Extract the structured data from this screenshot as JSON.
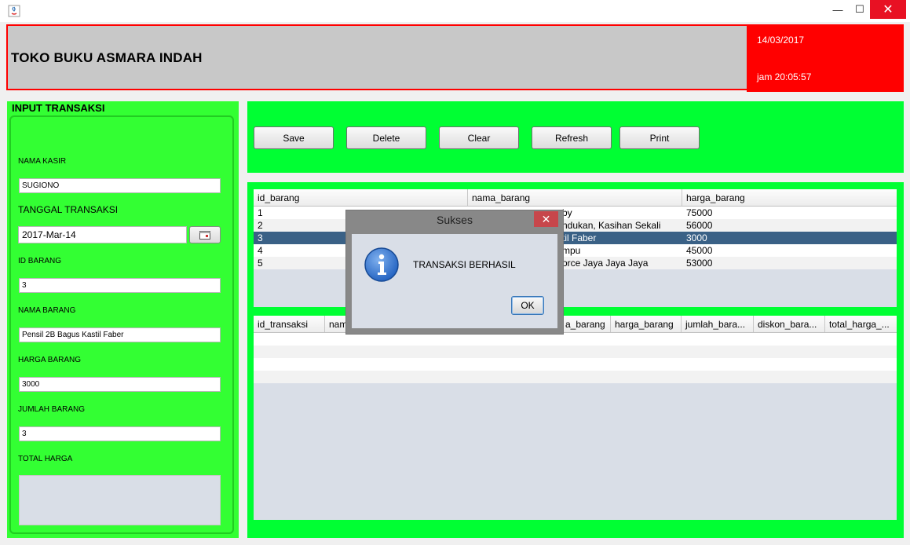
{
  "window": {
    "minimize_glyph": "—",
    "maximize_glyph": "☐",
    "close_glyph": "✕"
  },
  "header": {
    "store_name": "TOKO BUKU ASMARA INDAH",
    "date": "14/03/2017",
    "time": "jam 20:05:57"
  },
  "input_panel": {
    "title": "INPUT TRANSAKSI",
    "nama_kasir_label": "NAMA KASIR",
    "nama_kasir_value": "SUGIONO",
    "tanggal_label": "TANGGAL TRANSAKSI",
    "tanggal_value": "2017-Mar-14",
    "id_barang_label": "ID BARANG",
    "id_barang_value": "3",
    "nama_barang_label": "NAMA BARANG",
    "nama_barang_value": "Pensil 2B Bagus Kastil Faber",
    "harga_barang_label": "HARGA BARANG",
    "harga_barang_value": "3000",
    "jumlah_barang_label": "JUMLAH BARANG",
    "jumlah_barang_value": "3",
    "total_harga_label": "TOTAL HARGA",
    "total_harga_value": ""
  },
  "toolbar": {
    "save": "Save",
    "delete": "Delete",
    "clear": "Clear",
    "refresh": "Refresh",
    "print": "Print"
  },
  "barang_table": {
    "columns": [
      "id_barang",
      "nama_barang",
      "harga_barang"
    ],
    "rows": [
      [
        "1",
        "by",
        "75000"
      ],
      [
        "2",
        "ndukan, Kasihan Sekali",
        "56000"
      ],
      [
        "3",
        "til Faber",
        "3000"
      ],
      [
        "4",
        "mpu",
        "45000"
      ],
      [
        "5",
        "orce Jaya Jaya Jaya",
        "53000"
      ]
    ]
  },
  "transaksi_table": {
    "columns": [
      "id_transaksi",
      "nam",
      "a_barang",
      "harga_barang",
      "jumlah_bara...",
      "diskon_bara...",
      "total_harga_..."
    ]
  },
  "dialog": {
    "title": "Sukses",
    "message": "TRANSAKSI BERHASIL",
    "ok": "OK",
    "close_glyph": "✕"
  },
  "colors": {
    "header_red": "#ff0000",
    "panel_green": "#00ff33",
    "left_green": "#33ff33",
    "selected_row": "#3a6186"
  }
}
